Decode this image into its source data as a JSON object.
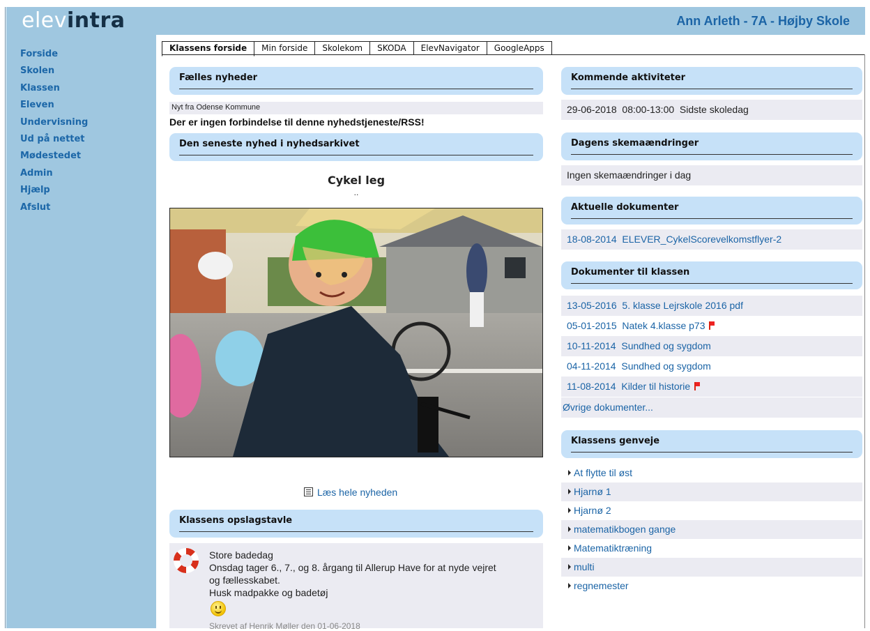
{
  "header": {
    "logo_part1": "elev",
    "logo_part2": "intra",
    "user": "Ann Arleth - 7A - Højby Skole"
  },
  "sidebar": {
    "items": [
      "Forside",
      "Skolen",
      "Klassen",
      "Eleven",
      "Undervisning",
      "Ud på nettet",
      "Mødestedet",
      "Admin",
      "Hjælp",
      "Afslut"
    ]
  },
  "tabs": [
    {
      "label": "Klassens forside",
      "active": true
    },
    {
      "label": "Min forside",
      "active": false
    },
    {
      "label": "Skolekom",
      "active": false
    },
    {
      "label": "SKODA",
      "active": false
    },
    {
      "label": "ElevNavigator",
      "active": false
    },
    {
      "label": "GoogleApps",
      "active": false
    }
  ],
  "news": {
    "heading": "Fælles nyheder",
    "source": "Nyt fra Odense Kommune",
    "error": "Der er ingen forbindelse til denne nyhedstjeneste/RSS!"
  },
  "latest": {
    "heading": "Den seneste nyhed i nyhedsarkivet",
    "title": "Cykel leg",
    "dots": "..",
    "read_more": "Læs hele nyheden"
  },
  "board": {
    "heading": "Klassens opslagstavle",
    "post_title": "Store badedag",
    "post_line1": "Onsdag tager 6., 7., og 8. årgang til Allerup Have for at nyde vejret",
    "post_line2": "og fællesskabet.",
    "post_line3": "Husk madpakke og badetøj",
    "footer": "Skrevet af Henrik Møller den 01-06-2018"
  },
  "activities": {
    "heading": "Kommende aktiviteter",
    "date": "29-06-2018",
    "time": "08:00-13:00",
    "text": "Sidste skoledag"
  },
  "schedule": {
    "heading": "Dagens skemaændringer",
    "text": "Ingen skemaændringer i dag"
  },
  "current_docs": {
    "heading": "Aktuelle dokumenter",
    "items": [
      {
        "date": "18-08-2014",
        "title": "ELEVER_CykelScorevelkomstflyer-2"
      }
    ]
  },
  "class_docs": {
    "heading": "Dokumenter til klassen",
    "items": [
      {
        "date": "13-05-2016",
        "title": "5. klasse Lejrskole 2016 pdf",
        "flag": false
      },
      {
        "date": "05-01-2015",
        "title": "Natek 4.klasse p73",
        "flag": true
      },
      {
        "date": "10-11-2014",
        "title": "Sundhed og sygdom",
        "flag": false
      },
      {
        "date": "04-11-2014",
        "title": "Sundhed og sygdom",
        "flag": false
      },
      {
        "date": "11-08-2014",
        "title": "Kilder til historie",
        "flag": true
      }
    ],
    "more": "Øvrige dokumenter..."
  },
  "shortcuts": {
    "heading": "Klassens genveje",
    "items": [
      "At flytte til øst",
      "Hjarnø 1",
      "Hjarnø 2",
      "matematikbogen gange",
      "Matematiktræning",
      "multi",
      "regnemester"
    ]
  },
  "colors": {
    "header_bg": "#9fc7e0",
    "box_header_bg": "#c6e1f8",
    "link": "#1b64a6",
    "row_alt": "#ebebf2",
    "flag": "#e02020"
  }
}
